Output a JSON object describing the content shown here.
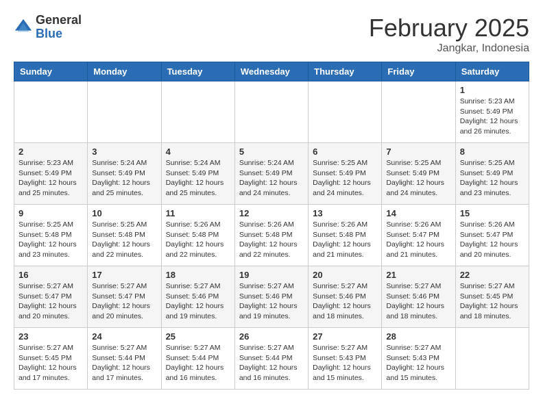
{
  "logo": {
    "general": "General",
    "blue": "Blue"
  },
  "header": {
    "month": "February 2025",
    "location": "Jangkar, Indonesia"
  },
  "days_of_week": [
    "Sunday",
    "Monday",
    "Tuesday",
    "Wednesday",
    "Thursday",
    "Friday",
    "Saturday"
  ],
  "weeks": [
    [
      {
        "day": "",
        "info": ""
      },
      {
        "day": "",
        "info": ""
      },
      {
        "day": "",
        "info": ""
      },
      {
        "day": "",
        "info": ""
      },
      {
        "day": "",
        "info": ""
      },
      {
        "day": "",
        "info": ""
      },
      {
        "day": "1",
        "info": "Sunrise: 5:23 AM\nSunset: 5:49 PM\nDaylight: 12 hours and 26 minutes."
      }
    ],
    [
      {
        "day": "2",
        "info": "Sunrise: 5:23 AM\nSunset: 5:49 PM\nDaylight: 12 hours and 25 minutes."
      },
      {
        "day": "3",
        "info": "Sunrise: 5:24 AM\nSunset: 5:49 PM\nDaylight: 12 hours and 25 minutes."
      },
      {
        "day": "4",
        "info": "Sunrise: 5:24 AM\nSunset: 5:49 PM\nDaylight: 12 hours and 25 minutes."
      },
      {
        "day": "5",
        "info": "Sunrise: 5:24 AM\nSunset: 5:49 PM\nDaylight: 12 hours and 24 minutes."
      },
      {
        "day": "6",
        "info": "Sunrise: 5:25 AM\nSunset: 5:49 PM\nDaylight: 12 hours and 24 minutes."
      },
      {
        "day": "7",
        "info": "Sunrise: 5:25 AM\nSunset: 5:49 PM\nDaylight: 12 hours and 24 minutes."
      },
      {
        "day": "8",
        "info": "Sunrise: 5:25 AM\nSunset: 5:49 PM\nDaylight: 12 hours and 23 minutes."
      }
    ],
    [
      {
        "day": "9",
        "info": "Sunrise: 5:25 AM\nSunset: 5:48 PM\nDaylight: 12 hours and 23 minutes."
      },
      {
        "day": "10",
        "info": "Sunrise: 5:25 AM\nSunset: 5:48 PM\nDaylight: 12 hours and 22 minutes."
      },
      {
        "day": "11",
        "info": "Sunrise: 5:26 AM\nSunset: 5:48 PM\nDaylight: 12 hours and 22 minutes."
      },
      {
        "day": "12",
        "info": "Sunrise: 5:26 AM\nSunset: 5:48 PM\nDaylight: 12 hours and 22 minutes."
      },
      {
        "day": "13",
        "info": "Sunrise: 5:26 AM\nSunset: 5:48 PM\nDaylight: 12 hours and 21 minutes."
      },
      {
        "day": "14",
        "info": "Sunrise: 5:26 AM\nSunset: 5:47 PM\nDaylight: 12 hours and 21 minutes."
      },
      {
        "day": "15",
        "info": "Sunrise: 5:26 AM\nSunset: 5:47 PM\nDaylight: 12 hours and 20 minutes."
      }
    ],
    [
      {
        "day": "16",
        "info": "Sunrise: 5:27 AM\nSunset: 5:47 PM\nDaylight: 12 hours and 20 minutes."
      },
      {
        "day": "17",
        "info": "Sunrise: 5:27 AM\nSunset: 5:47 PM\nDaylight: 12 hours and 20 minutes."
      },
      {
        "day": "18",
        "info": "Sunrise: 5:27 AM\nSunset: 5:46 PM\nDaylight: 12 hours and 19 minutes."
      },
      {
        "day": "19",
        "info": "Sunrise: 5:27 AM\nSunset: 5:46 PM\nDaylight: 12 hours and 19 minutes."
      },
      {
        "day": "20",
        "info": "Sunrise: 5:27 AM\nSunset: 5:46 PM\nDaylight: 12 hours and 18 minutes."
      },
      {
        "day": "21",
        "info": "Sunrise: 5:27 AM\nSunset: 5:46 PM\nDaylight: 12 hours and 18 minutes."
      },
      {
        "day": "22",
        "info": "Sunrise: 5:27 AM\nSunset: 5:45 PM\nDaylight: 12 hours and 18 minutes."
      }
    ],
    [
      {
        "day": "23",
        "info": "Sunrise: 5:27 AM\nSunset: 5:45 PM\nDaylight: 12 hours and 17 minutes."
      },
      {
        "day": "24",
        "info": "Sunrise: 5:27 AM\nSunset: 5:44 PM\nDaylight: 12 hours and 17 minutes."
      },
      {
        "day": "25",
        "info": "Sunrise: 5:27 AM\nSunset: 5:44 PM\nDaylight: 12 hours and 16 minutes."
      },
      {
        "day": "26",
        "info": "Sunrise: 5:27 AM\nSunset: 5:44 PM\nDaylight: 12 hours and 16 minutes."
      },
      {
        "day": "27",
        "info": "Sunrise: 5:27 AM\nSunset: 5:43 PM\nDaylight: 12 hours and 15 minutes."
      },
      {
        "day": "28",
        "info": "Sunrise: 5:27 AM\nSunset: 5:43 PM\nDaylight: 12 hours and 15 minutes."
      },
      {
        "day": "",
        "info": ""
      }
    ]
  ]
}
